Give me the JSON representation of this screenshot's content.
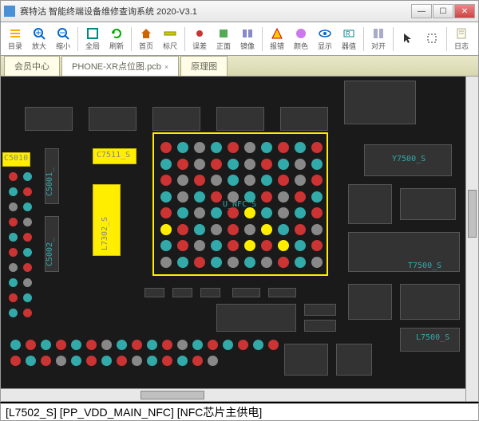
{
  "window": {
    "title": "赛特沽 智能终端设备维修查询系统 2020-V3.1"
  },
  "toolbar": {
    "items": [
      {
        "label": "目录",
        "icon": "list"
      },
      {
        "label": "放大",
        "icon": "zoom-in"
      },
      {
        "label": "缩小",
        "icon": "zoom-out"
      },
      {
        "sep": true
      },
      {
        "label": "全局",
        "icon": "full"
      },
      {
        "label": "刷新",
        "icon": "refresh"
      },
      {
        "sep": true
      },
      {
        "label": "首页",
        "icon": "home"
      },
      {
        "label": "标尺",
        "icon": "ruler"
      },
      {
        "sep": true
      },
      {
        "label": "误差",
        "icon": "dot"
      },
      {
        "label": "正面",
        "icon": "front"
      },
      {
        "label": "镜像",
        "icon": "mirror"
      },
      {
        "sep": true
      },
      {
        "label": "报错",
        "icon": "warn"
      },
      {
        "label": "颜色",
        "icon": "palette"
      },
      {
        "label": "显示",
        "icon": "eye"
      },
      {
        "label": "器值",
        "icon": "val"
      },
      {
        "sep": true
      },
      {
        "label": "对开",
        "icon": "split"
      },
      {
        "sep": true
      },
      {
        "label": "",
        "icon": "cursor"
      },
      {
        "label": "",
        "icon": "sel"
      },
      {
        "sep": true
      },
      {
        "label": "日志",
        "icon": "log"
      }
    ]
  },
  "tabs": [
    {
      "label": "会员中心",
      "active": false,
      "closable": false
    },
    {
      "label": "PHONE-XR点位图.pcb",
      "active": true,
      "closable": true
    },
    {
      "label": "原理图",
      "active": false,
      "closable": false
    }
  ],
  "pcb": {
    "components": {
      "c5010": "C5010",
      "c5001": "C5001_",
      "c7511": "C7511_S",
      "c5002": "C5002_",
      "l7302": "L7302_S",
      "unfc": "U_NFC_S",
      "y7500": "Y7500_S",
      "t7500": "T7500_S",
      "l7500": "L7500_S"
    }
  },
  "status": {
    "text": "[L7502_S] [PP_VDD_MAIN_NFC] [NFC芯片主供电]"
  }
}
